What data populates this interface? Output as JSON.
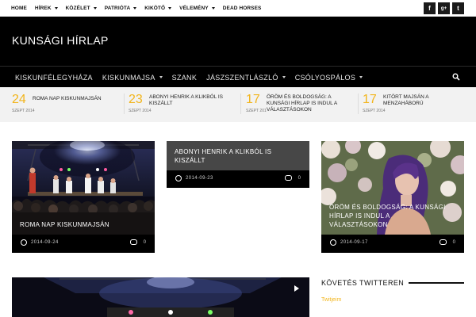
{
  "topnav": {
    "items": [
      {
        "label": "HOME",
        "dropdown": false
      },
      {
        "label": "HÍREK",
        "dropdown": true
      },
      {
        "label": "KÖZÉLET",
        "dropdown": true
      },
      {
        "label": "PATRIÓTA",
        "dropdown": true
      },
      {
        "label": "KIKÖTŐ",
        "dropdown": true
      },
      {
        "label": "VÉLEMÉNY",
        "dropdown": true
      },
      {
        "label": "DEAD HORSES",
        "dropdown": false
      }
    ],
    "social": [
      {
        "glyph": "f",
        "icon": "facebook-icon"
      },
      {
        "glyph": "g+",
        "icon": "google-plus-icon"
      },
      {
        "glyph": "t",
        "icon": "twitter-icon"
      }
    ]
  },
  "header": {
    "title": "KUNSÁGI HÍRLAP"
  },
  "mainnav": {
    "items": [
      {
        "label": "KISKUNFÉLEGYHÁZA",
        "dropdown": false
      },
      {
        "label": "KISKUNMAJSA",
        "dropdown": true
      },
      {
        "label": "SZANK",
        "dropdown": false
      },
      {
        "label": "JÁSZSZENTLÁSZLÓ",
        "dropdown": true
      },
      {
        "label": "CSÓLYOSPÁLOS",
        "dropdown": true
      }
    ]
  },
  "ticker": [
    {
      "day": "24",
      "headline": [
        "ROMA NAP KISKUNMAJSÁN"
      ],
      "date": "SZEPT 2014"
    },
    {
      "day": "23",
      "headline": [
        "ABONYI HENRIK A KLIKBÓL IS",
        "KISZÁLLT"
      ],
      "date": "SZEPT 2014"
    },
    {
      "day": "17",
      "headline": [
        "ÖRÖM ÉS BOLDOGSÁG: A",
        "KUNSÁGI HÍRLAP IS INDUL A",
        "VÁLASZTÁSOKON"
      ],
      "date": "SZEPT 2014"
    },
    {
      "day": "17",
      "headline": [
        "KITÖRT MAJSÁN A",
        "MENZAHÁBORÚ"
      ],
      "date": "SZEPT 2014"
    }
  ],
  "cards": [
    {
      "title": [
        "ROMA NAP KISKUNMAJSÁN"
      ],
      "date": "2014-09-24",
      "comments": "0"
    },
    {
      "title": [
        "ABONYI HENRIK A KLIKBÓL IS",
        "KISZÁLLT"
      ],
      "date": "2014-09-23",
      "comments": "0"
    },
    {
      "title": [
        "ÖRÖM ÉS BOLDOGSÁG: A KUNSÁGI",
        "HÍRLAP IS INDUL A",
        "VÁLASZTÁSOKON"
      ],
      "date": "2014-09-17",
      "comments": "0"
    }
  ],
  "sidebar": {
    "heading": "KÖVETÉS TWITTEREN",
    "twitter_link": "Twitjeim"
  },
  "colors": {
    "accent": "#f2b51c",
    "header_bg": "#000000",
    "ticker_bg": "#f2f2f2"
  }
}
